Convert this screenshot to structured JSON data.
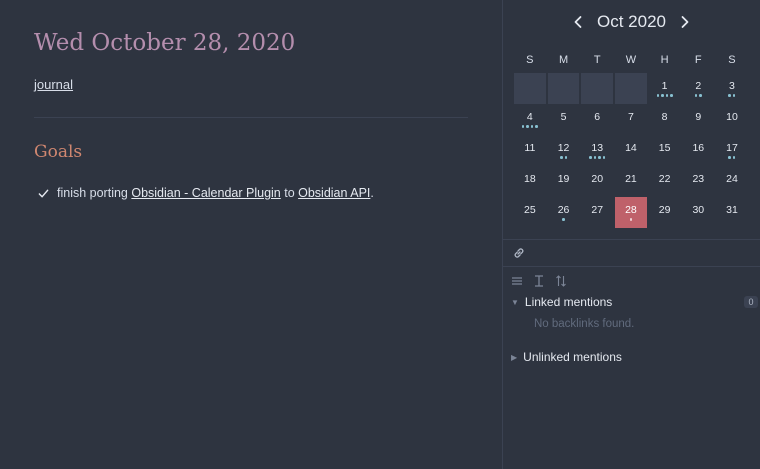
{
  "note": {
    "title": "Wed October 28, 2020",
    "tag": "journal",
    "heading": "Goals",
    "task": {
      "prefix": "finish porting ",
      "link1": "Obsidian - Calendar Plugin",
      "middle": " to ",
      "link2": "Obsidian API",
      "suffix": "."
    }
  },
  "calendar": {
    "month_label": "Oct 2020",
    "prev_icon": "chevron-left-icon",
    "next_icon": "chevron-right-icon",
    "weekdays": [
      "S",
      "M",
      "T",
      "W",
      "H",
      "F",
      "S"
    ],
    "weeks": [
      [
        {
          "d": "",
          "adj": true
        },
        {
          "d": "",
          "adj": true
        },
        {
          "d": "",
          "adj": true
        },
        {
          "d": "",
          "adj": true
        },
        {
          "d": "1",
          "dots": 4
        },
        {
          "d": "2",
          "dots": 2
        },
        {
          "d": "3",
          "dots": 2
        }
      ],
      [
        {
          "d": "4",
          "dots": 4
        },
        {
          "d": "5"
        },
        {
          "d": "6"
        },
        {
          "d": "7"
        },
        {
          "d": "8"
        },
        {
          "d": "9"
        },
        {
          "d": "10"
        }
      ],
      [
        {
          "d": "11"
        },
        {
          "d": "12",
          "dots": 2
        },
        {
          "d": "13",
          "dots": 4
        },
        {
          "d": "14"
        },
        {
          "d": "15"
        },
        {
          "d": "16"
        },
        {
          "d": "17",
          "dots": 2
        }
      ],
      [
        {
          "d": "18"
        },
        {
          "d": "19"
        },
        {
          "d": "20"
        },
        {
          "d": "21"
        },
        {
          "d": "22"
        },
        {
          "d": "23"
        },
        {
          "d": "24"
        }
      ],
      [
        {
          "d": "25"
        },
        {
          "d": "26",
          "dots": 1
        },
        {
          "d": "27"
        },
        {
          "d": "28",
          "dots": 1,
          "today": true
        },
        {
          "d": "29"
        },
        {
          "d": "30"
        },
        {
          "d": "31"
        }
      ]
    ]
  },
  "backlinks": {
    "link_icon": "link-icon",
    "tools": [
      "list-icon",
      "text-cursor-icon",
      "sort-icon"
    ],
    "linked_label": "Linked mentions",
    "linked_count": "0",
    "empty_text": "No backlinks found.",
    "unlinked_label": "Unlinked mentions"
  },
  "colors": {
    "background": "#2e3440",
    "title": "#b48ead",
    "heading": "#d08770",
    "today": "#bf616a",
    "dot": "#88c0d0"
  }
}
